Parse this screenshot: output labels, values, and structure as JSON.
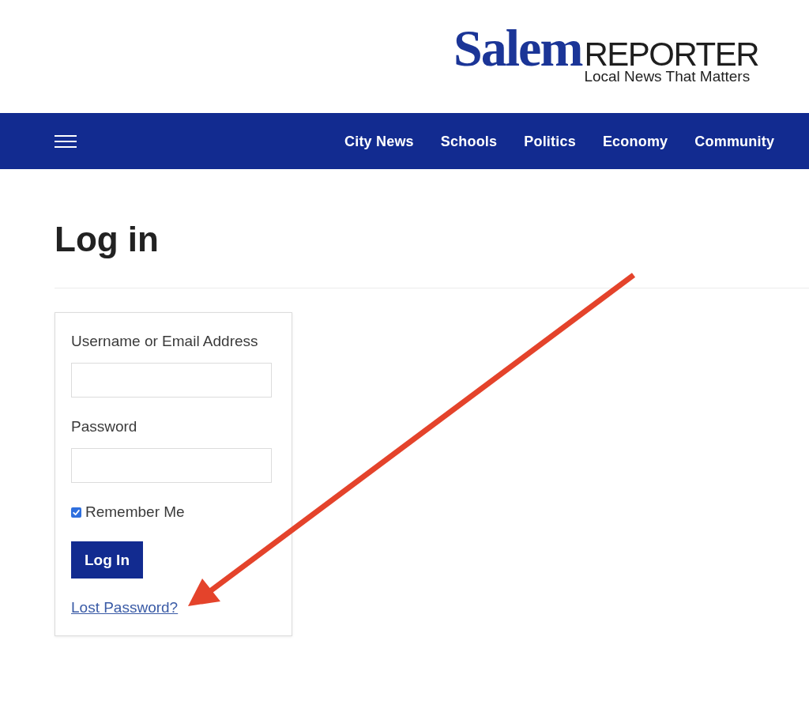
{
  "header": {
    "logo": {
      "name": "Salem",
      "word": "REPORTER",
      "tagline": "Local News That Matters"
    }
  },
  "nav": {
    "items": [
      "City News",
      "Schools",
      "Politics",
      "Economy",
      "Community"
    ]
  },
  "page": {
    "title": "Log in"
  },
  "login_form": {
    "fields": [
      {
        "label": "Username or Email Address"
      },
      {
        "label": "Password"
      }
    ],
    "remember": {
      "label": "Remember Me",
      "checked": true
    },
    "submit": "Log In",
    "lost_password": "Lost Password?"
  }
}
